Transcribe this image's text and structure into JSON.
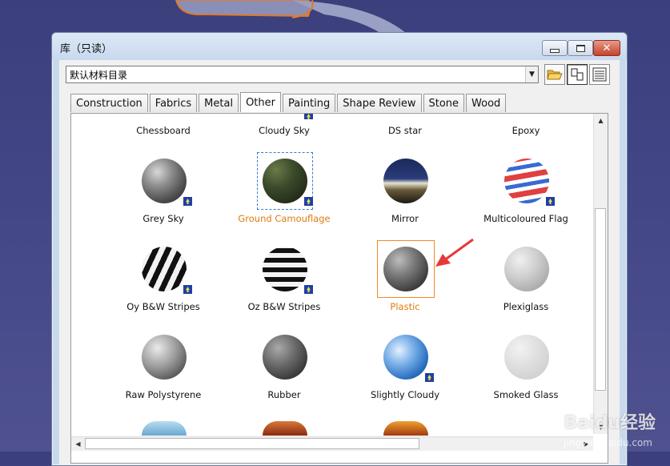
{
  "window": {
    "title": "库（只读）",
    "catalog_selector": "默认材料目录"
  },
  "tabs": [
    {
      "label": "Construction",
      "selected": false
    },
    {
      "label": "Fabrics",
      "selected": false
    },
    {
      "label": "Metal",
      "selected": false
    },
    {
      "label": "Other",
      "selected": true
    },
    {
      "label": "Painting",
      "selected": false
    },
    {
      "label": "Shape Review",
      "selected": false
    },
    {
      "label": "Stone",
      "selected": false
    },
    {
      "label": "Wood",
      "selected": false
    }
  ],
  "materials": {
    "top_row_labels": [
      "Chessboard",
      "Cloudy Sky",
      "DS star",
      "Epoxy"
    ],
    "items": [
      {
        "label": "Grey Sky",
        "linked": true
      },
      {
        "label": "Ground Camouflage",
        "linked": true,
        "highlighted": true
      },
      {
        "label": "Mirror",
        "linked": false
      },
      {
        "label": "Multicoloured Flag",
        "linked": true
      },
      {
        "label": "Oy B&W Stripes",
        "linked": true
      },
      {
        "label": "Oz B&W Stripes",
        "linked": true
      },
      {
        "label": "Plastic",
        "linked": false,
        "selected": true
      },
      {
        "label": "Plexiglass",
        "linked": false
      },
      {
        "label": "Raw Polystyrene",
        "linked": false
      },
      {
        "label": "Rubber",
        "linked": false
      },
      {
        "label": "Slightly Cloudy",
        "linked": true
      },
      {
        "label": "Smoked Glass",
        "linked": false
      }
    ]
  },
  "watermark": {
    "text": "Baidu经验",
    "url_text": "jingyan.baidu.com"
  },
  "colors": {
    "selected_label": "#e07a10",
    "annotation_arrow": "#e83838",
    "link_badge": "#1e3fa8"
  }
}
